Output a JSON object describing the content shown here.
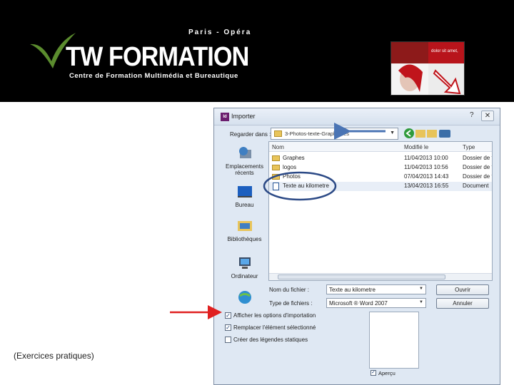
{
  "header": {
    "city": "Paris - Opéra",
    "brand": "TW FORMATION",
    "tagline": "Centre de Formation Multimédia et Bureautique",
    "promo_line1": "",
    "promo_line2": "dolor sit amet,",
    "colors": {
      "background": "#000000",
      "check": "#5b8c2e",
      "text": "#ffffff"
    }
  },
  "dialog": {
    "title": "Importer",
    "app_icon": "Id",
    "help": "?",
    "close": "✕",
    "look_in_label": "Regarder dans :",
    "look_in_value": "3-Photos-texte-Graphiques",
    "places": [
      {
        "icon": "recent-places-icon",
        "label_line1": "Emplacements",
        "label_line2": "récents"
      },
      {
        "icon": "desktop-icon",
        "label_line1": "Bureau",
        "label_line2": ""
      },
      {
        "icon": "libraries-icon",
        "label_line1": "Bibliothèques",
        "label_line2": ""
      },
      {
        "icon": "computer-icon",
        "label_line1": "Ordinateur",
        "label_line2": ""
      },
      {
        "icon": "network-icon",
        "label_line1": "",
        "label_line2": ""
      }
    ],
    "columns": [
      "Nom",
      "Modifié le",
      "Type"
    ],
    "rows": [
      {
        "type": "folder",
        "name": "Graphes",
        "modified": "11/04/2013 10:00",
        "kind": "Dossier de f"
      },
      {
        "type": "folder",
        "name": "logos",
        "modified": "11/04/2013 10:56",
        "kind": "Dossier de f"
      },
      {
        "type": "folder",
        "name": "Photos",
        "modified": "07/04/2013 14:43",
        "kind": "Dossier de f"
      },
      {
        "type": "doc",
        "name": "Texte au kilometre",
        "modified": "13/04/2013 16:55",
        "kind": "Document"
      }
    ],
    "filename_label": "Nom du fichier :",
    "filename_value": "Texte au kilometre",
    "filetype_label": "Type de fichiers :",
    "filetype_value": "Microsoft ® Word 2007",
    "open_button": "Ouvrir",
    "cancel_button": "Annuler",
    "checkboxes": [
      {
        "label": "Afficher les options d'importation",
        "checked": true
      },
      {
        "label": "Remplacer l'élément sélectionné",
        "checked": true
      },
      {
        "label": "Créer des légendes statiques",
        "checked": false
      }
    ],
    "preview_label": "Aperçu",
    "preview_checked": true
  },
  "caption": "(Exercices pratiques)",
  "annotation_colors": {
    "arrow_blue": "#4a74b4",
    "circle": "#2c4a86",
    "arrow_red": "#e02020"
  }
}
